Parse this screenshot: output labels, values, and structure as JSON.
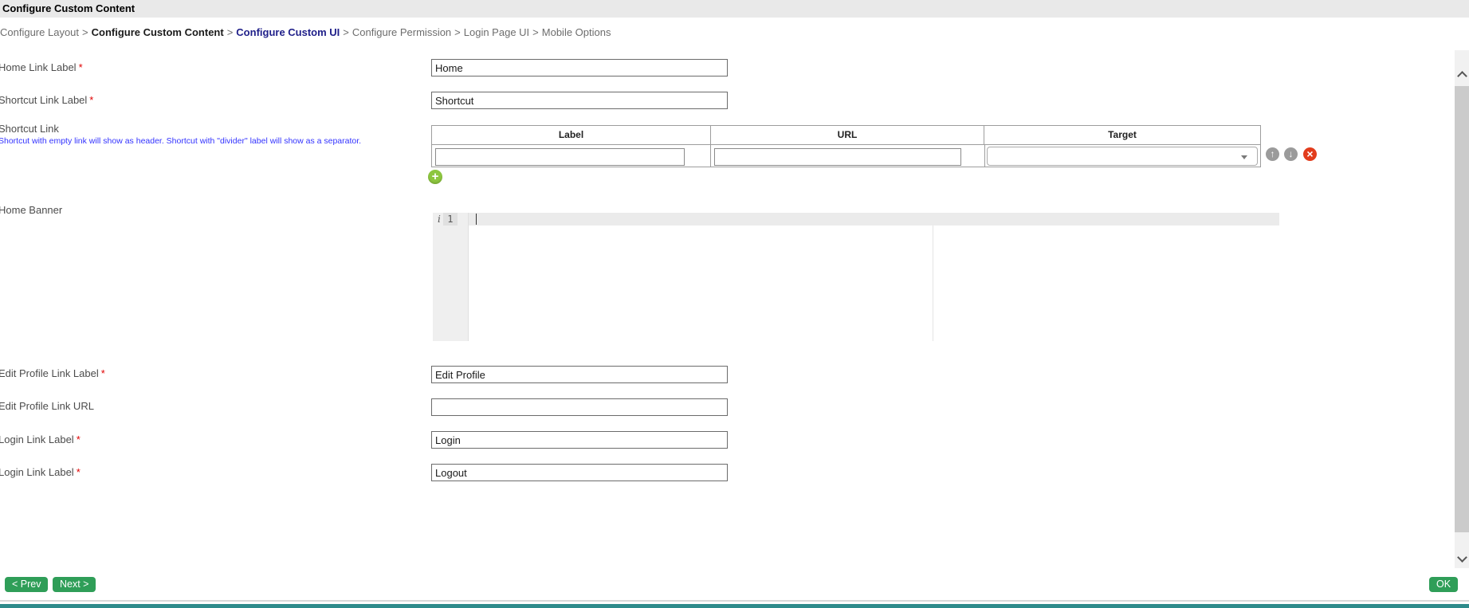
{
  "title_bar": {
    "title": "Configure Custom Content"
  },
  "breadcrumb": {
    "separator": ">",
    "items": [
      {
        "label": "Configure Layout"
      },
      {
        "label": "Configure Custom Content"
      },
      {
        "label": "Configure Custom UI"
      },
      {
        "label": "Configure Permission"
      },
      {
        "label": "Login Page UI"
      },
      {
        "label": "Mobile Options"
      }
    ]
  },
  "fields": {
    "home_link": {
      "label": "Home Link Label",
      "required_mark": "*",
      "value": "Home"
    },
    "shortcut_link_label": {
      "label": "Shortcut Link Label",
      "required_mark": "*",
      "value": "Shortcut"
    },
    "shortcut_link": {
      "label": "Shortcut Link",
      "help_text": "Shortcut with empty link will show as header. Shortcut with \"divider\" label will show as a separator.",
      "columns": [
        "Label",
        "URL",
        "Target"
      ],
      "row": {
        "label_value": "",
        "url_value": "",
        "target_value": ""
      }
    },
    "home_banner": {
      "label": "Home Banner",
      "editor": {
        "gutter_marker": "i",
        "line_number": "1",
        "content": ""
      }
    },
    "edit_profile_link_label": {
      "label": "Edit Profile Link Label",
      "required_mark": "*",
      "value": "Edit Profile"
    },
    "edit_profile_link_url": {
      "label": "Edit Profile Link URL",
      "value": ""
    },
    "login_link_label": {
      "label": "Login Link Label",
      "required_mark": "*",
      "value": "Login"
    },
    "logout_link_label": {
      "label": "Login Link Label",
      "required_mark": "*",
      "value": "Logout"
    }
  },
  "icons": {
    "move_up": "↑",
    "move_down": "↓",
    "delete": "×",
    "add": "+"
  },
  "footer": {
    "prev": "< Prev",
    "next": "Next >",
    "ok": "OK"
  },
  "colors": {
    "button_green": "#2f9e58",
    "delete_red": "#e23c1c",
    "add_green": "#8dc63f",
    "help_blue": "#3333ff",
    "breadcrumb_active_blue": "#20208a",
    "footer_teal": "#2e8b8b"
  }
}
